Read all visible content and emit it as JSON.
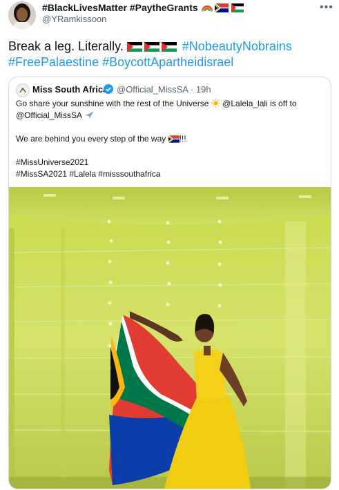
{
  "author": {
    "display_name": "#BlackLivesMatter #PaytheGrants",
    "handle": "@YRamkissoon"
  },
  "more_icon": "more-horizontal-icon",
  "tweet": {
    "text_prefix": "Break a leg. Literally.",
    "hashtags": [
      "#NobeautyNobrains",
      "#FreePalaestine",
      "#BoycottApartheidisrael"
    ]
  },
  "quoted": {
    "name": "Miss South Africa",
    "handle": "@Official_MissSA",
    "separator": "·",
    "time": "19h",
    "lines": [
      "Go share your sunshine with the rest of the Universe",
      "@Lalela_lali is off to",
      "@Official_MissSA",
      "We are behind you every step of the way",
      "!!!",
      "#MissUniverse2021",
      "#MissSA2021 #Lalela #misssouthafrica"
    ]
  },
  "colors": {
    "link": "#1d9bf0",
    "secondary_text": "#536471",
    "border": "#cfd9de",
    "verified": "#1d9bf0"
  }
}
